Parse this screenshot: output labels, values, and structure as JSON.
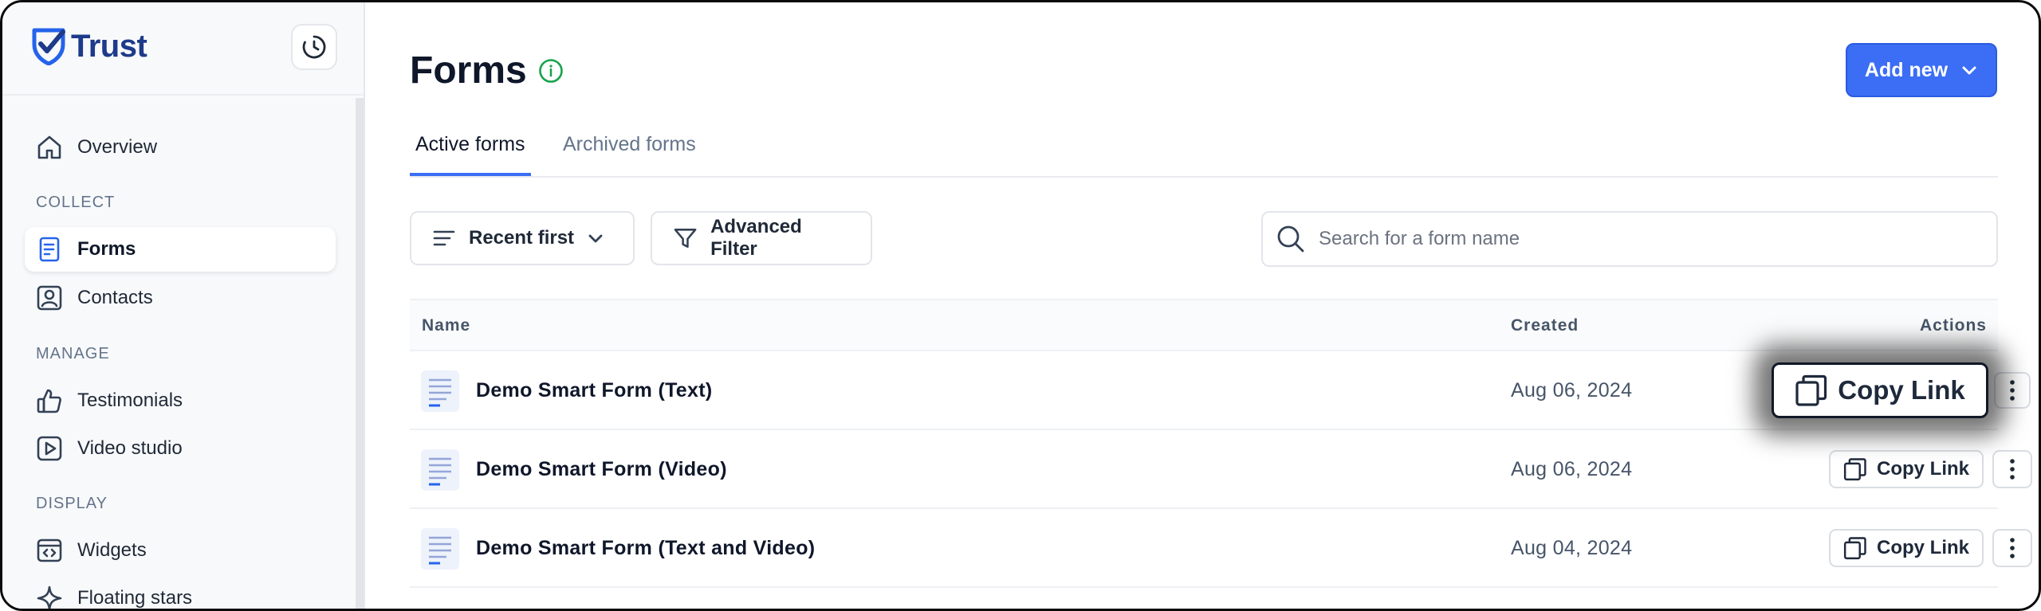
{
  "brand": {
    "name": "Trust"
  },
  "colors": {
    "accent": "#3b6ef5",
    "brand": "#1e3a8a",
    "info_green": "#16a34a"
  },
  "sidebar": {
    "overview": "Overview",
    "sections": [
      {
        "label": "COLLECT",
        "items": [
          "Forms",
          "Contacts"
        ]
      },
      {
        "label": "MANAGE",
        "items": [
          "Testimonials",
          "Video studio"
        ]
      },
      {
        "label": "DISPLAY",
        "items": [
          "Widgets",
          "Floating stars"
        ]
      }
    ],
    "active_item": "Forms"
  },
  "page": {
    "title": "Forms",
    "add_button": "Add new"
  },
  "tabs": [
    {
      "label": "Active forms",
      "active": true
    },
    {
      "label": "Archived forms",
      "active": false
    }
  ],
  "toolbar": {
    "sort_label": "Recent first",
    "filter_label": "Advanced Filter",
    "search_placeholder": "Search for a form name",
    "search_value": ""
  },
  "table": {
    "columns": [
      "Name",
      "Created",
      "Actions"
    ],
    "copy_label": "Copy Link",
    "rows": [
      {
        "name": "Demo Smart Form (Text)",
        "created": "Aug 06, 2024"
      },
      {
        "name": "Demo Smart Form (Video)",
        "created": "Aug 06, 2024"
      },
      {
        "name": "Demo Smart Form (Text and Video)",
        "created": "Aug 04, 2024"
      }
    ]
  }
}
